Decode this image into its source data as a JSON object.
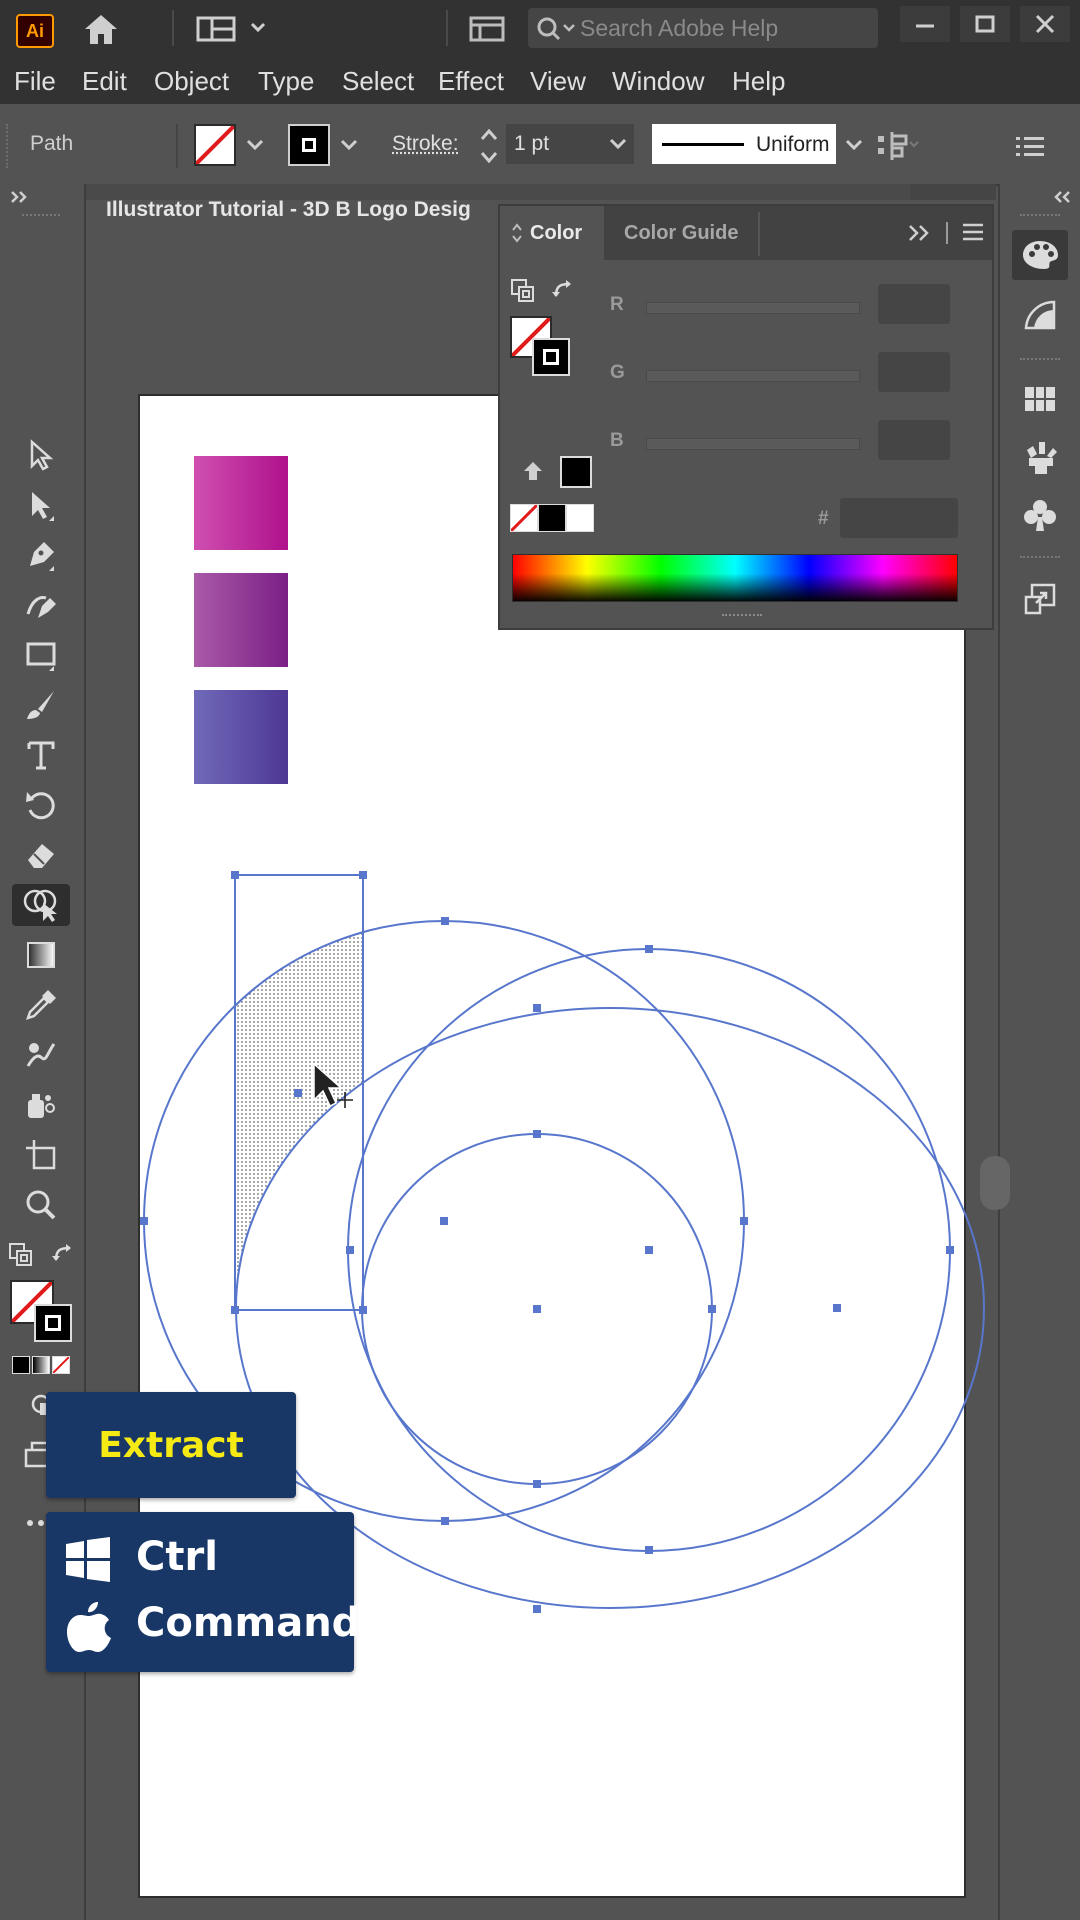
{
  "app": {
    "logo_text": "Ai",
    "search_placeholder": "Search Adobe Help"
  },
  "menu": [
    "File",
    "Edit",
    "Object",
    "Type",
    "Select",
    "Effect",
    "View",
    "Window",
    "Help"
  ],
  "control_bar": {
    "selection_label": "Path",
    "stroke_label": "Stroke:",
    "stroke_weight": "1 pt",
    "profile_label": "Uniform"
  },
  "document": {
    "tab_title": "Illustrator Tutorial - 3D B Logo Desig"
  },
  "color_panel": {
    "tabs": [
      "Color",
      "Color Guide"
    ],
    "channels": [
      "R",
      "G",
      "B"
    ],
    "hex_label": "#"
  },
  "swatches": [
    {
      "from": "#cf4fb0",
      "to": "#b0118c"
    },
    {
      "from": "#a95aa8",
      "to": "#7b1f86"
    },
    {
      "from": "#7069b9",
      "to": "#4e3894"
    }
  ],
  "overlay": {
    "action_label": "Extract",
    "windows_key": "Ctrl",
    "mac_key": "Command"
  },
  "colors": {
    "selection_blue": "#5877cc",
    "accent_yellow": "#f5ea14",
    "overlay_bg": "#183767"
  }
}
